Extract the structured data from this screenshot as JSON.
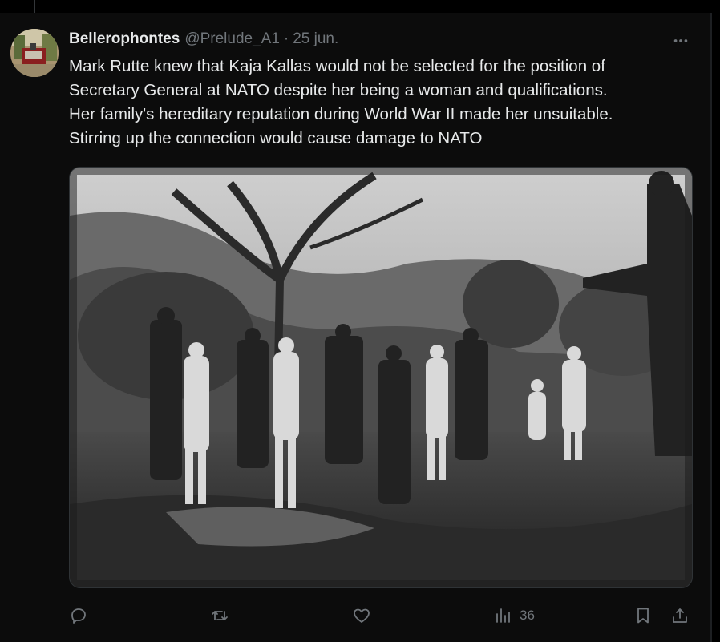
{
  "tweet": {
    "author_name": "Bellerophontes",
    "author_handle": "@Prelude_A1",
    "separator": "·",
    "date": "25 jun.",
    "text_lines": [
      "Mark Rutte knew that Kaja Kallas would not be selected for the position of",
      "Secretary General at NATO despite her being a woman and qualifications.",
      "Her family's hereditary reputation during World War II made her unsuitable.",
      "Stirring up the connection would cause damage to NATO"
    ]
  },
  "icons": {
    "more": "more-horizontal-icon",
    "reply": "reply-icon",
    "repost": "repost-icon",
    "like": "heart-icon",
    "views": "views-bar-chart-icon",
    "bookmark": "bookmark-icon",
    "share": "share-icon"
  },
  "actions": {
    "views_count": "36"
  },
  "colors": {
    "background": "#000000",
    "panel": "#0c0c0c",
    "text_primary": "#e7e9ea",
    "text_secondary": "#71767b"
  }
}
